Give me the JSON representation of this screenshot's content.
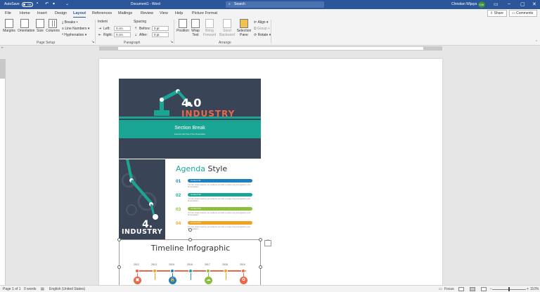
{
  "titlebar": {
    "autosave_label": "AutoSave",
    "autosave_state": "Off",
    "doc_title": "Document1 - Word",
    "search_placeholder": "Search",
    "user_name": "Christian Wijaya",
    "user_initials": "CW"
  },
  "tabs": [
    "File",
    "Home",
    "Insert",
    "Design",
    "Layout",
    "References",
    "Mailings",
    "Review",
    "View",
    "Help",
    "Picture Format"
  ],
  "active_tab": "Layout",
  "share_label": "Share",
  "comments_label": "Comments",
  "ribbon": {
    "page_setup": {
      "margins": "Margins",
      "orientation": "Orientation",
      "size": "Size",
      "columns": "Columns",
      "breaks": "Breaks",
      "line_numbers": "Line Numbers",
      "hyphenation": "Hyphenation",
      "group_label": "Page Setup"
    },
    "paragraph": {
      "indent_label": "Indent",
      "left_label": "Left:",
      "left_value": "0 cm",
      "right_label": "Right:",
      "right_value": "0 cm",
      "spacing_label": "Spacing",
      "before_label": "Before:",
      "before_value": "0 pt",
      "after_label": "After:",
      "after_value": "0 pt",
      "group_label": "Paragraph"
    },
    "arrange": {
      "position": "Position",
      "wrap_text": "Wrap Text",
      "bring_forward": "Bring Forward",
      "send_backward": "Send Backward",
      "selection_pane": "Selection Pane",
      "align": "Align",
      "group": "Group",
      "rotate": "Rotate",
      "group_label": "Arrange"
    }
  },
  "document": {
    "slide1": {
      "four": "4.0",
      "industry": "INDUSTRY",
      "band_title": "Section Break",
      "band_subtitle": "Insert the Sub Title of Your Presentation"
    },
    "slide2": {
      "four": "4.",
      "industry": "INDUSTRY",
      "agenda_word1": "Agenda",
      "agenda_word2": "Style",
      "items": [
        {
          "num": "01",
          "bar": "Content 01",
          "color": "#1d7fbf"
        },
        {
          "num": "02",
          "bar": "Content 02",
          "color": "#1aa695"
        },
        {
          "num": "03",
          "bar": "Content 03",
          "color": "#8cbf3f"
        },
        {
          "num": "04",
          "bar": "Content 04",
          "color": "#f0a21e"
        }
      ],
      "item_text": "You can simply impress your audience and add a unique zing and appeal to your Presentations."
    },
    "slide3": {
      "title": "Timeline Infographic",
      "years": [
        "2012",
        "2013",
        "2015",
        "2016",
        "2017",
        "2018",
        "2019"
      ],
      "year_colors": [
        "#e8684a",
        "#f0a21e",
        "#1d7fbf",
        "#1aa695",
        "#8cbf3f",
        "#f0a21e",
        "#e8684a"
      ],
      "icons": [
        {
          "name": "briefcase-icon",
          "glyph": "▣",
          "color": "#e8684a"
        },
        {
          "name": "lock-icon",
          "glyph": "🔒",
          "color": "#1d7fbf"
        },
        {
          "name": "cloud-icon",
          "glyph": "☁",
          "color": "#8cbf3f"
        },
        {
          "name": "gear-icon",
          "glyph": "✿",
          "color": "#e8684a"
        }
      ]
    }
  },
  "statusbar": {
    "page": "Page 1 of 1",
    "words": "0 words",
    "language": "English (United States)",
    "focus": "Focus",
    "zoom": "110%"
  }
}
